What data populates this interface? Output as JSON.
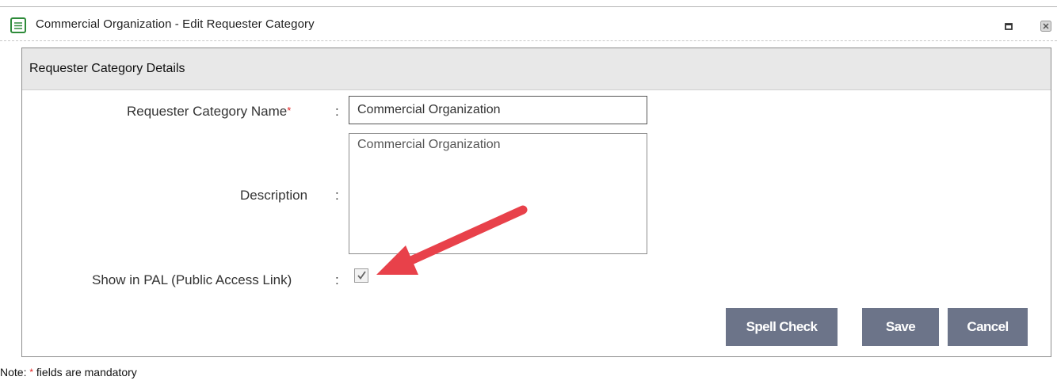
{
  "window": {
    "title": "Commercial Organization - Edit Requester Category",
    "icon": "form-icon",
    "controls": [
      "maximize-icon",
      "close-icon"
    ]
  },
  "panel": {
    "title": "Requester Category Details"
  },
  "form": {
    "name_label": "Requester Category Name",
    "required_mark": "*",
    "colon": ":",
    "name_value": "Commercial Organization",
    "description_label": "Description",
    "description_value": "Commercial Organization",
    "pal_label": "Show in PAL (Public Access Link)",
    "pal_checked": true
  },
  "buttons": {
    "spell_check": "Spell Check",
    "save": "Save",
    "cancel": "Cancel"
  },
  "note": {
    "prefix": "Note:",
    "star": "*",
    "text": "fields are mandatory"
  },
  "colors": {
    "button_bg": "#6c7489",
    "header_bg": "#e8e8e8",
    "required": "#e02020",
    "arrow": "#e8414a"
  }
}
